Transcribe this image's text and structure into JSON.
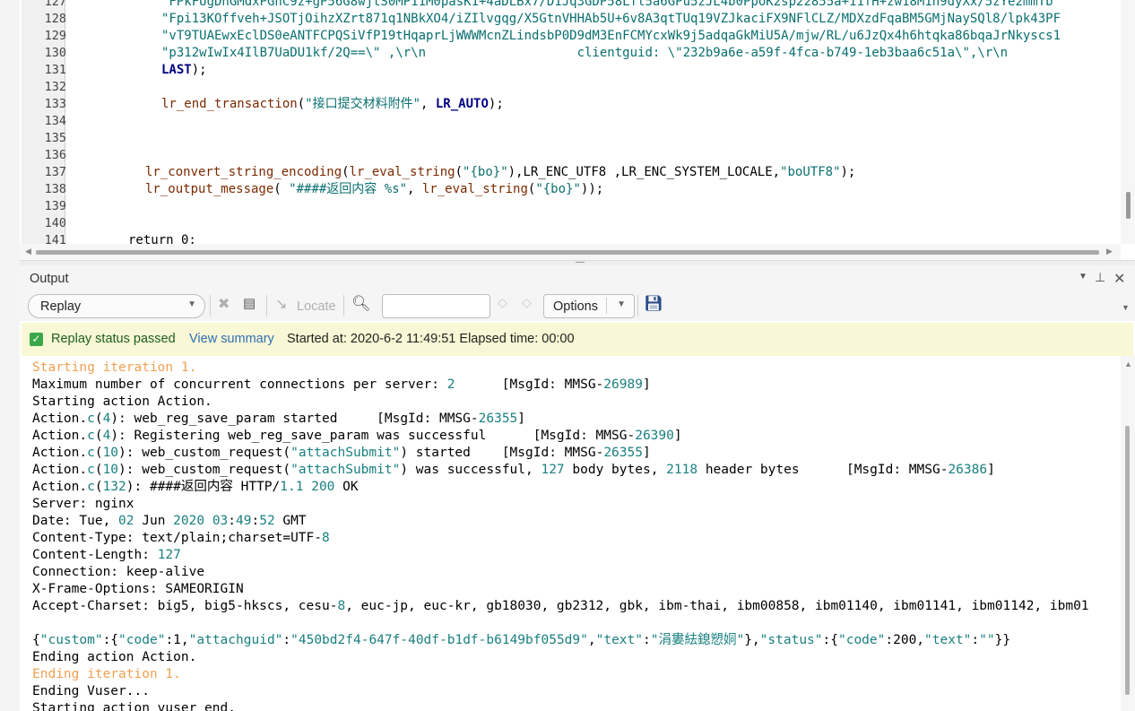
{
  "editor": {
    "lines": [
      {
        "num": "127",
        "segments": [
          {
            "t": "\"FPkFUgDhGMdxPGhC9z+gP56G8wjtS0MP11M0pasK1+4aDLBx7/D1Jq3GDP58Lfl5a6GPu5zJL4b0PpoK2sp22855a+11fH+zw18M1n9dyXx/5zYe2mmTb",
            "c": "str"
          }
        ]
      },
      {
        "num": "128",
        "segments": [
          {
            "t": "\"Fpi13KOffveh+JSOTjOihzXZrt871q1NBkXO4/iZIlvgqg/X5GtnVHHAb5U+6v8A3qtTUq19VZJkaciFX9NFlCLZ/MDXzdFqaBM5GMjNaySQl8/lpk43PF",
            "c": "str"
          }
        ]
      },
      {
        "num": "129",
        "segments": [
          {
            "t": "\"vT9TUAEwxEclDS0eANTFCPQSiVfP19tHqaprLjWWWMcnZLindsbP0D9dM3EnFCMYcxWk9j5adqaGkMiU5A/mjw/RL/u6JzQx4h6htqka86bqaJrNkyscs1",
            "c": "str"
          }
        ]
      },
      {
        "num": "130",
        "segments": [
          {
            "t": "\"p312wIwIx4IlB7UaDU1kf/2Q==\\\" ,\\r\\n                    clientguid: \\\"232b9a6e-a59f-4fca-b749-1eb3baa6c51a\\\",\\r\\n",
            "c": "str"
          }
        ]
      },
      {
        "num": "131",
        "segments": [
          {
            "t": "LAST",
            "c": "kw"
          },
          {
            "t": ");",
            "c": "blk"
          }
        ]
      },
      {
        "num": "132",
        "segments": []
      },
      {
        "num": "133",
        "segments": [
          {
            "t": "lr_end_transaction",
            "c": "fn"
          },
          {
            "t": "(",
            "c": "blk"
          },
          {
            "t": "\"接口提交材料附件\"",
            "c": "str"
          },
          {
            "t": ", ",
            "c": "blk"
          },
          {
            "t": "LR_AUTO",
            "c": "kw"
          },
          {
            "t": ");",
            "c": "blk"
          }
        ]
      },
      {
        "num": "134",
        "segments": []
      },
      {
        "num": "135",
        "segments": []
      },
      {
        "num": "136",
        "segments": []
      },
      {
        "num": "137",
        "segments": [
          {
            "t": "lr_convert_string_encoding",
            "c": "fn"
          },
          {
            "t": "(",
            "c": "blk"
          },
          {
            "t": "lr_eval_string",
            "c": "fn"
          },
          {
            "t": "(",
            "c": "blk"
          },
          {
            "t": "\"{bo}\"",
            "c": "str"
          },
          {
            "t": "),LR_ENC_UTF8 ,LR_ENC_SYSTEM_LOCALE,",
            "c": "blk"
          },
          {
            "t": "\"boUTF8\"",
            "c": "str"
          },
          {
            "t": ");",
            "c": "blk"
          }
        ]
      },
      {
        "num": "138",
        "segments": [
          {
            "t": "lr_output_message",
            "c": "fn"
          },
          {
            "t": "( ",
            "c": "blk"
          },
          {
            "t": "\"####返回内容 %s\"",
            "c": "str"
          },
          {
            "t": ", ",
            "c": "blk"
          },
          {
            "t": "lr_eval_string",
            "c": "fn"
          },
          {
            "t": "(",
            "c": "blk"
          },
          {
            "t": "\"{bo}\"",
            "c": "str"
          },
          {
            "t": "));",
            "c": "blk"
          }
        ]
      },
      {
        "num": "139",
        "segments": []
      },
      {
        "num": "140",
        "segments": []
      },
      {
        "num": "141",
        "segments": [
          {
            "t": "return 0;",
            "c": "blk"
          }
        ]
      }
    ]
  },
  "output": {
    "title": "Output",
    "toolbar": {
      "replay_label": "Replay",
      "locate_label": "Locate",
      "search_value": "",
      "options_label": "Options"
    },
    "status": {
      "passed_text": "Replay status passed",
      "view_summary": "View summary",
      "started": "Started at: 2020-6-2 11:49:51 Elapsed time: 00:00"
    },
    "log_lines": [
      [
        {
          "t": "Starting iteration 1.",
          "c": "orange"
        }
      ],
      [
        {
          "t": "Maximum number of concurrent connections per server: "
        },
        {
          "t": "2",
          "c": "teal"
        },
        {
          "t": "      [MsgId: MMSG-"
        },
        {
          "t": "26989",
          "c": "teal"
        },
        {
          "t": "]"
        }
      ],
      [
        {
          "t": "Starting action Action."
        }
      ],
      [
        {
          "t": "Action."
        },
        {
          "t": "c",
          "c": "teal"
        },
        {
          "t": "("
        },
        {
          "t": "4",
          "c": "teal"
        },
        {
          "t": "): web_reg_save_param started     [MsgId: MMSG-"
        },
        {
          "t": "26355",
          "c": "teal"
        },
        {
          "t": "]"
        }
      ],
      [
        {
          "t": "Action."
        },
        {
          "t": "c",
          "c": "teal"
        },
        {
          "t": "("
        },
        {
          "t": "4",
          "c": "teal"
        },
        {
          "t": "): Registering web_reg_save_param was successful      [MsgId: MMSG-"
        },
        {
          "t": "26390",
          "c": "teal"
        },
        {
          "t": "]"
        }
      ],
      [
        {
          "t": "Action."
        },
        {
          "t": "c",
          "c": "teal"
        },
        {
          "t": "("
        },
        {
          "t": "10",
          "c": "teal"
        },
        {
          "t": "): web_custom_request("
        },
        {
          "t": "\"attachSubmit\"",
          "c": "teal"
        },
        {
          "t": ") started    [MsgId: MMSG-"
        },
        {
          "t": "26355",
          "c": "teal"
        },
        {
          "t": "]"
        }
      ],
      [
        {
          "t": "Action."
        },
        {
          "t": "c",
          "c": "teal"
        },
        {
          "t": "("
        },
        {
          "t": "10",
          "c": "teal"
        },
        {
          "t": "): web_custom_request("
        },
        {
          "t": "\"attachSubmit\"",
          "c": "teal"
        },
        {
          "t": ") was successful, "
        },
        {
          "t": "127",
          "c": "teal"
        },
        {
          "t": " body bytes, "
        },
        {
          "t": "2118",
          "c": "teal"
        },
        {
          "t": " header bytes      [MsgId: MMSG-"
        },
        {
          "t": "26386",
          "c": "teal"
        },
        {
          "t": "]"
        }
      ],
      [
        {
          "t": "Action."
        },
        {
          "t": "c",
          "c": "teal"
        },
        {
          "t": "("
        },
        {
          "t": "132",
          "c": "teal"
        },
        {
          "t": "): ####返回内容 HTTP/"
        },
        {
          "t": "1.1",
          "c": "teal"
        },
        {
          "t": " "
        },
        {
          "t": "200",
          "c": "teal"
        },
        {
          "t": " OK"
        }
      ],
      [
        {
          "t": "Server: nginx"
        }
      ],
      [
        {
          "t": "Date: Tue, "
        },
        {
          "t": "02",
          "c": "teal"
        },
        {
          "t": " Jun "
        },
        {
          "t": "2020",
          "c": "teal"
        },
        {
          "t": " "
        },
        {
          "t": "03",
          "c": "teal"
        },
        {
          "t": ":"
        },
        {
          "t": "49",
          "c": "teal"
        },
        {
          "t": ":"
        },
        {
          "t": "52",
          "c": "teal"
        },
        {
          "t": " GMT"
        }
      ],
      [
        {
          "t": "Content-Type: text/plain;charset=UTF-"
        },
        {
          "t": "8",
          "c": "teal"
        }
      ],
      [
        {
          "t": "Content-Length: "
        },
        {
          "t": "127",
          "c": "teal"
        }
      ],
      [
        {
          "t": "Connection: keep-alive"
        }
      ],
      [
        {
          "t": "X-Frame-Options: SAMEORIGIN"
        }
      ],
      [
        {
          "t": "Accept-Charset: big5, big5-hkscs, cesu-"
        },
        {
          "t": "8",
          "c": "teal"
        },
        {
          "t": ", euc-jp, euc-kr, gb18030, gb2312, gbk, ibm-thai, ibm00858, ibm01140, ibm01141, ibm01142, ibm01"
        }
      ],
      [],
      [
        {
          "t": "{"
        },
        {
          "t": "\"custom\"",
          "c": "teal"
        },
        {
          "t": ":{"
        },
        {
          "t": "\"code\"",
          "c": "teal"
        },
        {
          "t": ":1,"
        },
        {
          "t": "\"attachguid\"",
          "c": "teal"
        },
        {
          "t": ":"
        },
        {
          "t": "\"450bd2f4-647f-40df-b1df-b6149bf055d9\"",
          "c": "teal"
        },
        {
          "t": ","
        },
        {
          "t": "\"text\"",
          "c": "teal"
        },
        {
          "t": ":"
        },
        {
          "t": "\"涓婁紶鎴愬姛\"",
          "c": "teal"
        },
        {
          "t": "},"
        },
        {
          "t": "\"status\"",
          "c": "teal"
        },
        {
          "t": ":{"
        },
        {
          "t": "\"code\"",
          "c": "teal"
        },
        {
          "t": ":200,"
        },
        {
          "t": "\"text\"",
          "c": "teal"
        },
        {
          "t": ":"
        },
        {
          "t": "\"\"",
          "c": "teal"
        },
        {
          "t": "}}"
        }
      ],
      [
        {
          "t": "Ending action Action."
        }
      ],
      [
        {
          "t": "Ending iteration 1.",
          "c": "orange"
        }
      ],
      [
        {
          "t": "Ending Vuser..."
        }
      ],
      [
        {
          "t": "Starting action vuser_end."
        }
      ]
    ]
  }
}
